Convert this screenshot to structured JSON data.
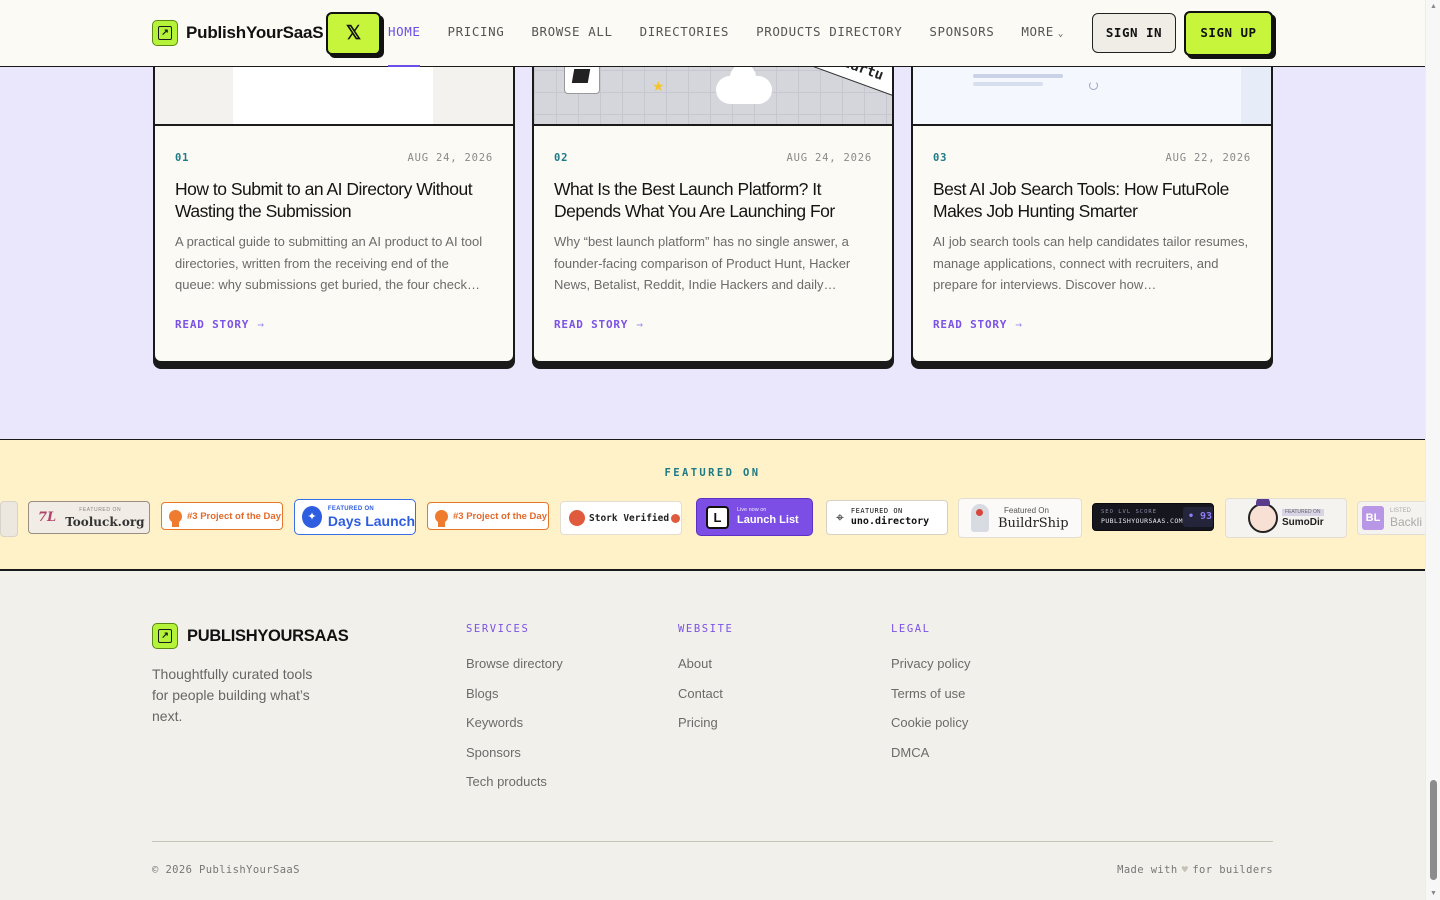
{
  "header": {
    "logo_text": "PublishYourSaaS",
    "x_button": "𝕏",
    "nav": [
      {
        "label": "HOME"
      },
      {
        "label": "PRICING"
      },
      {
        "label": "BROWSE ALL"
      },
      {
        "label": "DIRECTORIES"
      },
      {
        "label": "PRODUCTS DIRECTORY"
      },
      {
        "label": "SPONSORS"
      },
      {
        "label": "MORE"
      }
    ],
    "more_chevron": "⌄",
    "signin_label": "SIGN IN",
    "signup_label": "SIGN UP",
    "accent": "#6a4ee8",
    "cta_color": "#c6f53c"
  },
  "cards": [
    {
      "num": "01",
      "date": "AUG 24, 2026",
      "title": "How to Submit to an AI Directory Without Wasting the Submission",
      "excerpt": "A practical guide to submitting an AI product to AI tool directories, written from the receiving end of the queue: why submissions get buried, the four check…",
      "read_label": "READ STORY",
      "read_icon": "arrow-right-icon"
    },
    {
      "num": "02",
      "date": "AUG 24, 2026",
      "title": "What Is the Best Launch Platform? It Depends What You Are Launching For",
      "excerpt": "Why “best launch platform” has no single answer, a founder-facing comparison of Product Hunt, Hacker News, Betalist, Reddit, Indie Hackers and daily…",
      "read_label": "READ STORY",
      "read_icon": "arrow-right-icon",
      "thumb_banner": "p Startu"
    },
    {
      "num": "03",
      "date": "AUG 22, 2026",
      "title": "Best AI Job Search Tools: How FutuRole Makes Job Hunting Smarter",
      "excerpt": "AI job search tools can help candidates tailor resumes, manage applications, connect with recruiters, and prepare for interviews. Discover how…",
      "read_label": "READ STORY",
      "read_icon": "arrow-right-icon"
    }
  ],
  "featured": {
    "title": "FEATURED ON",
    "badges": {
      "tooluck": {
        "small": "FEATURED ON",
        "name": "Tooluck.org",
        "icon": "7L"
      },
      "potd": {
        "label": "#3 Project of the Day"
      },
      "days": {
        "small": "FEATURED ON",
        "name": "Days Launch"
      },
      "stork": {
        "label": "Stork Verified"
      },
      "launchlist": {
        "letter": "L",
        "small": "Live now on",
        "name": "Launch List"
      },
      "uno": {
        "small": "FEATURED ON",
        "name": "uno.directory"
      },
      "buildr": {
        "small": "Featured On",
        "name": "BuildrShip"
      },
      "seo": {
        "small": "SEO LVL SCORE",
        "name": "PUBLISHYOURSAAS.COM",
        "score": "• 93"
      },
      "sumo": {
        "small": "FEATURED ON",
        "name": "SumoDir"
      },
      "bl": {
        "letter": "BL",
        "small": "LISTED",
        "name": "Backli"
      }
    },
    "background": "#fff1c8"
  },
  "footer": {
    "logo_text": "PUBLISHYOURSAAS",
    "tagline": "Thoughtfully curated tools for people building what’s next.",
    "columns": [
      {
        "title": "SERVICES",
        "links": [
          "Browse directory",
          "Blogs",
          "Keywords",
          "Sponsors",
          "Tech products"
        ]
      },
      {
        "title": "WEBSITE",
        "links": [
          "About",
          "Contact",
          "Pricing"
        ]
      },
      {
        "title": "LEGAL",
        "links": [
          "Privacy policy",
          "Terms of use",
          "Cookie policy",
          "DMCA"
        ]
      }
    ],
    "copyright": "© 2026 PublishYourSaaS",
    "made_prefix": "Made with",
    "made_suffix": "for builders"
  }
}
